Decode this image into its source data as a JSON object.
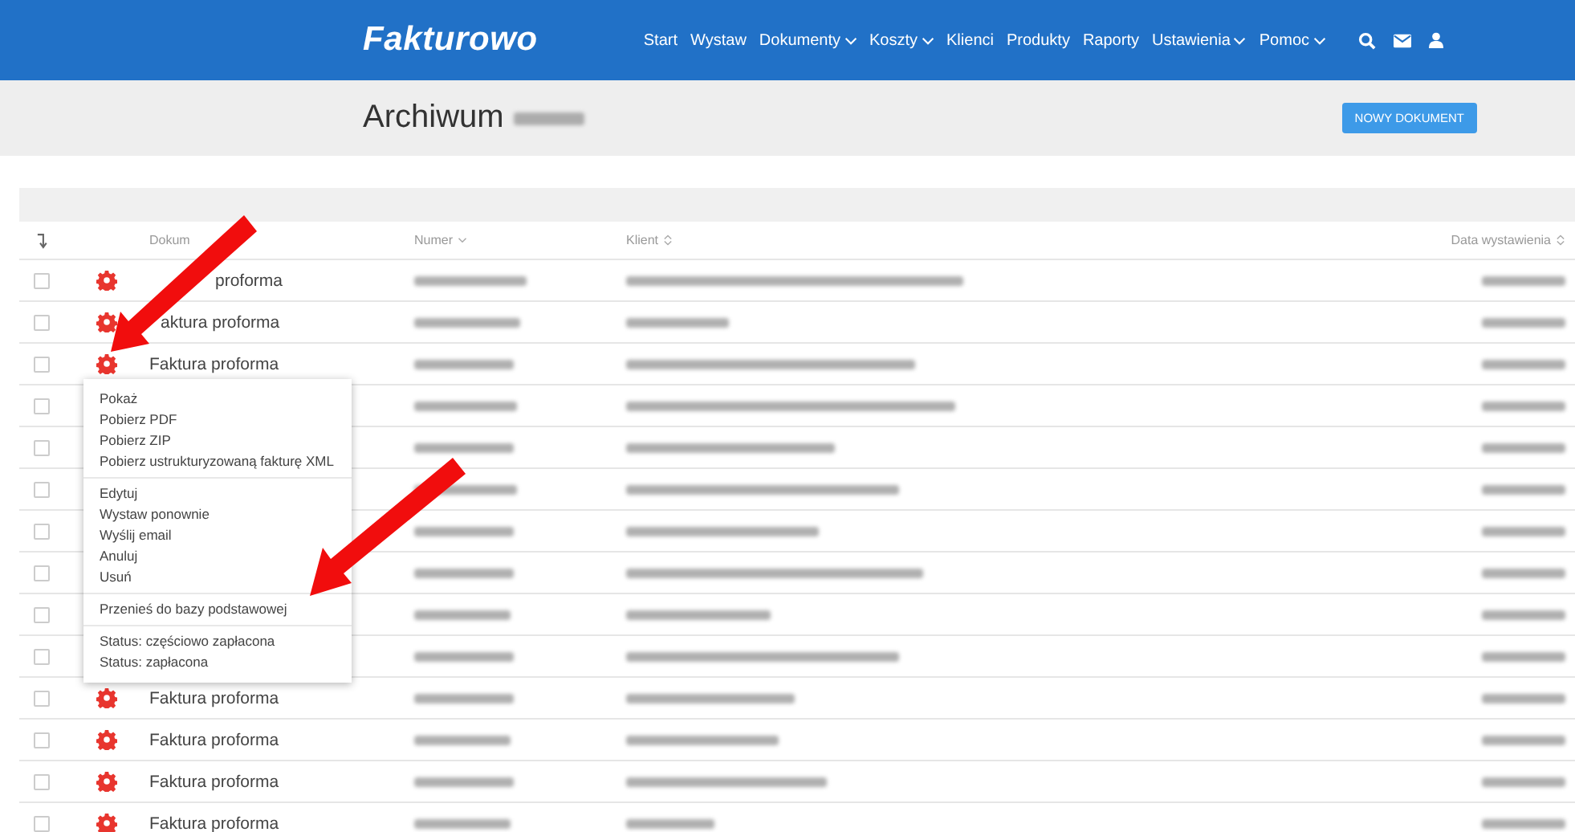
{
  "navbar": {
    "logo": "Fakturowo",
    "items": [
      {
        "label": "Start",
        "dropdown": false
      },
      {
        "label": "Wystaw",
        "dropdown": false
      },
      {
        "label": "Dokumenty",
        "dropdown": true
      },
      {
        "label": "Koszty",
        "dropdown": true
      },
      {
        "label": "Klienci",
        "dropdown": false
      },
      {
        "label": "Produkty",
        "dropdown": false
      },
      {
        "label": "Raporty",
        "dropdown": false
      },
      {
        "label": "Ustawienia",
        "dropdown": true
      },
      {
        "label": "Pomoc",
        "dropdown": true
      }
    ]
  },
  "page_header": {
    "title": "Archiwum",
    "button": "NOWY DOKUMENT"
  },
  "table": {
    "columns": [
      {
        "label": "Dokum",
        "sortable": false
      },
      {
        "label": "Numer",
        "sortable": true,
        "sorted": true
      },
      {
        "label": "Klient",
        "sortable": true,
        "sorted": false
      },
      {
        "label": "Data wystawienia",
        "sortable": true,
        "sorted": false
      }
    ],
    "rows": [
      {
        "checked": false,
        "document": "proforma"
      },
      {
        "checked": false,
        "document": "aktura proforma"
      },
      {
        "checked": false,
        "document": "Faktura proforma"
      },
      {
        "checked": false
      },
      {
        "checked": false
      },
      {
        "checked": false
      },
      {
        "checked": false
      },
      {
        "checked": false
      },
      {
        "checked": false
      },
      {
        "checked": false
      },
      {
        "checked": false,
        "document": "Faktura proforma"
      },
      {
        "checked": false,
        "document": "Faktura proforma"
      },
      {
        "checked": false,
        "document": "Faktura proforma"
      },
      {
        "checked": false,
        "document": "Faktura proforma"
      }
    ]
  },
  "context_menu": {
    "groups": [
      [
        "Pokaż",
        "Pobierz PDF",
        "Pobierz ZIP",
        "Pobierz ustrukturyzowaną fakturę XML"
      ],
      [
        "Edytuj",
        "Wystaw ponownie",
        "Wyślij email",
        "Anuluj",
        "Usuń"
      ],
      [
        "Przenieś do bazy podstawowej"
      ],
      [
        "Status: częściowo zapłacona",
        "Status: zapłacona"
      ]
    ]
  }
}
